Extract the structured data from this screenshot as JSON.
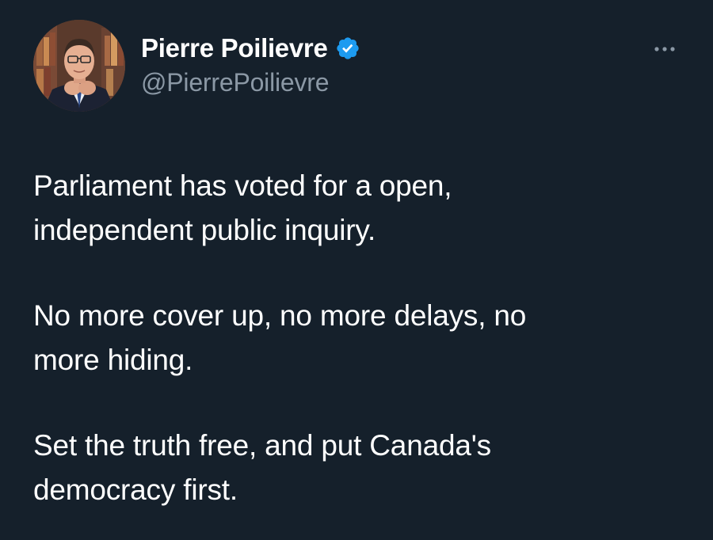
{
  "author": {
    "display_name": "Pierre Poilievre",
    "handle": "@PierrePoilievre",
    "verified": true,
    "verified_icon": "verified-badge-icon",
    "avatar_icon": "profile-photo"
  },
  "more_menu": {
    "icon": "more-horizontal-icon"
  },
  "tweet": {
    "paragraphs": [
      {
        "lines": [
          "Parliament has voted for a open,",
          "independent public inquiry."
        ]
      },
      {
        "lines": [
          "No more cover up, no more delays, no",
          "more hiding."
        ]
      },
      {
        "lines": [
          "Set the truth free, and put Canada's",
          "democracy first."
        ]
      }
    ]
  },
  "colors": {
    "background": "#15202b",
    "text": "#ffffff",
    "secondary_text": "#8b98a5",
    "verified_blue": "#1d9bf0"
  }
}
